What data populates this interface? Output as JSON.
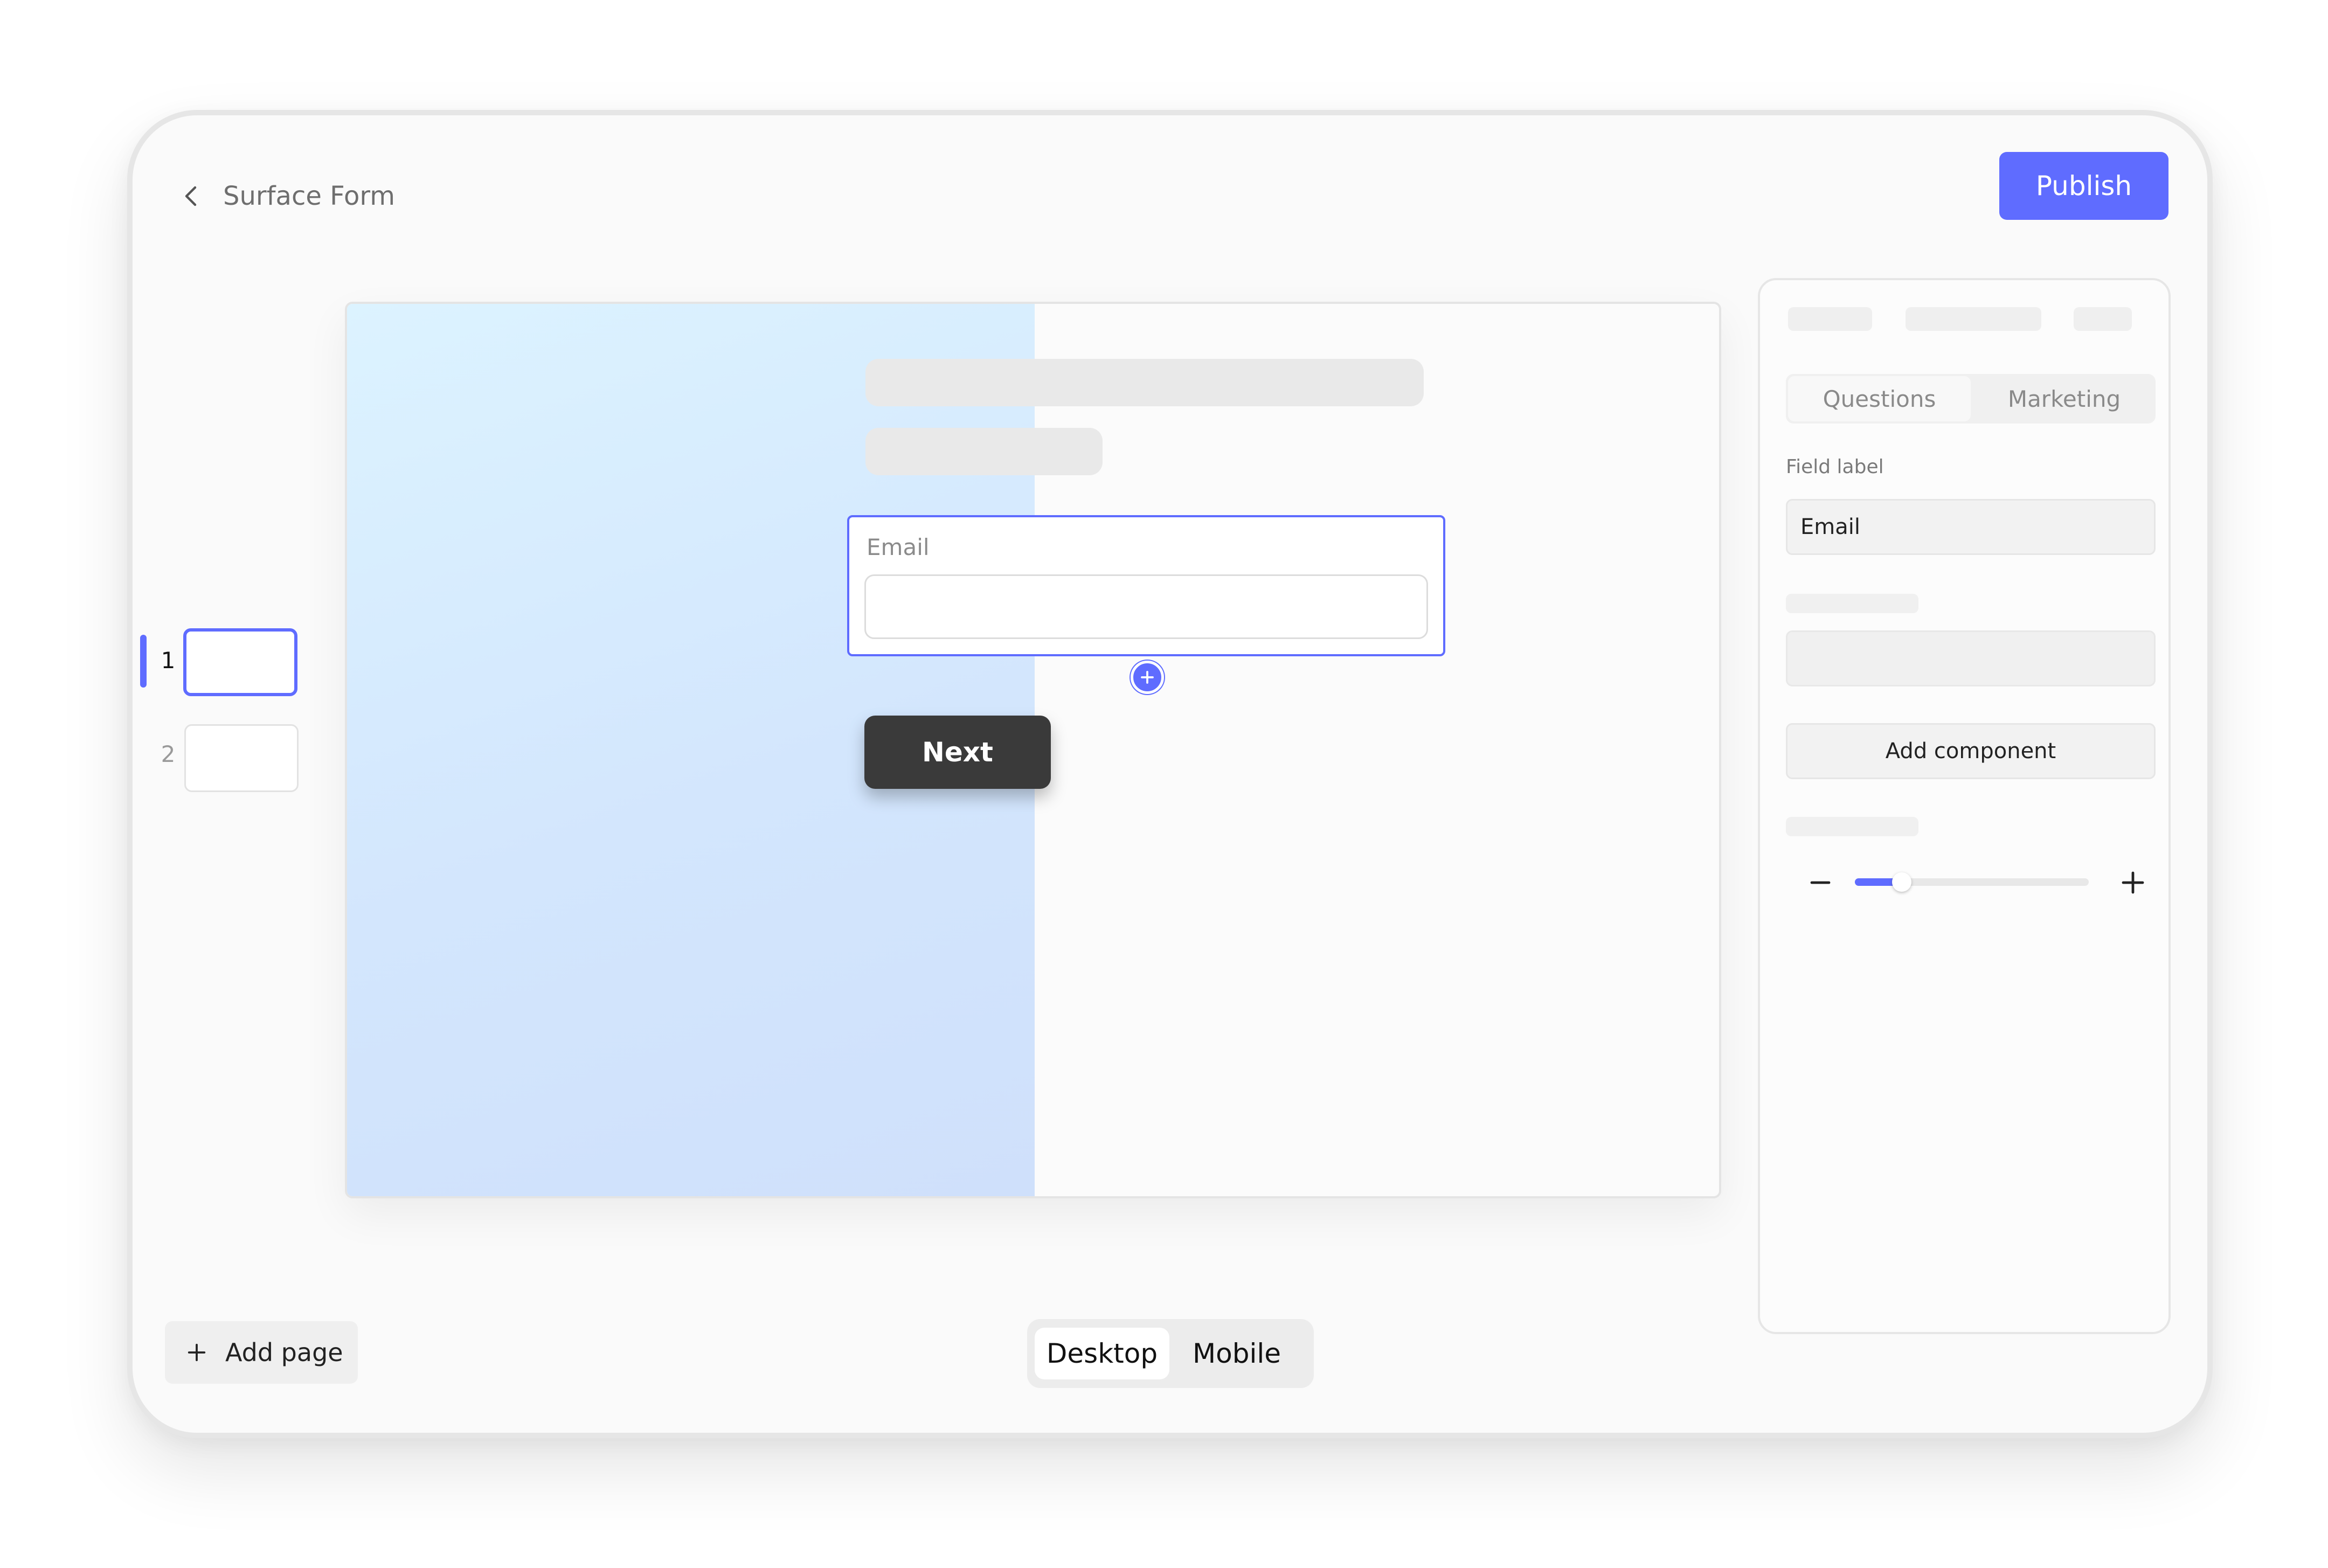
{
  "header": {
    "title": "Surface Form",
    "publish_label": "Publish"
  },
  "pages": {
    "items": [
      {
        "number": "1",
        "active": true
      },
      {
        "number": "2",
        "active": false
      }
    ],
    "add_page_label": "Add page"
  },
  "canvas": {
    "email_label": "Email",
    "email_value": "",
    "next_label": "Next"
  },
  "view_toggle": {
    "options": [
      "Desktop",
      "Mobile"
    ],
    "selected": "Desktop"
  },
  "panel": {
    "tabs": [
      "Questions",
      "Marketing"
    ],
    "active_tab": "Questions",
    "field_label_heading": "Field label",
    "field_label_value": "Email",
    "add_component_label": "Add component",
    "zoom_level": 0.2
  },
  "icons": {
    "back": "chevron-left-icon",
    "add_field": "plus-icon",
    "add_page": "plus-icon",
    "zoom_out": "minus-icon",
    "zoom_in": "plus-icon"
  },
  "colors": {
    "accent": "#5f6cff",
    "next_button": "#3a3a3a",
    "canvas_gradient_start": "#dcf3ff",
    "canvas_gradient_end": "#cfe0fb"
  }
}
